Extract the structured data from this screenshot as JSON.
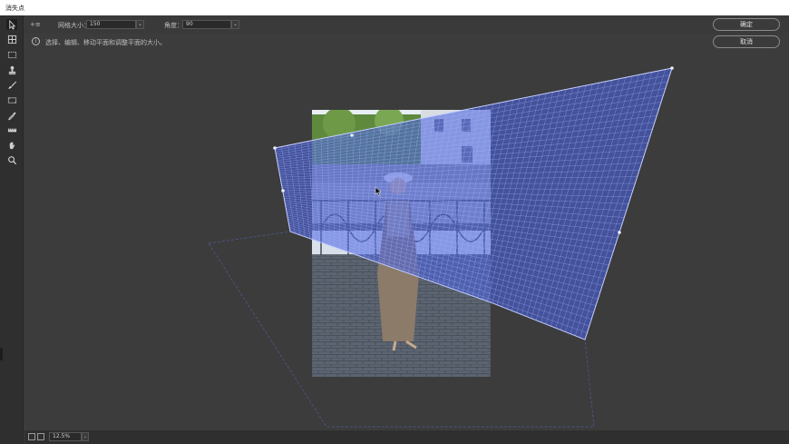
{
  "window": {
    "title": "消失点"
  },
  "toolbar": {
    "tools": [
      {
        "name": "edit-plane-tool",
        "icon": "arrow-cursor-icon"
      },
      {
        "name": "create-plane-tool",
        "icon": "grid-plane-icon"
      },
      {
        "name": "marquee-tool",
        "icon": "marquee-icon"
      },
      {
        "name": "stamp-tool",
        "icon": "stamp-icon"
      },
      {
        "name": "brush-tool",
        "icon": "brush-icon"
      },
      {
        "name": "transform-tool",
        "icon": "transform-icon"
      },
      {
        "name": "eyedropper-tool",
        "icon": "eyedropper-icon"
      },
      {
        "name": "measure-tool",
        "icon": "ruler-icon"
      },
      {
        "name": "hand-tool",
        "icon": "hand-icon"
      },
      {
        "name": "zoom-tool",
        "icon": "magnifier-icon"
      }
    ]
  },
  "options": {
    "corner_mark": "+≡",
    "grid_size_label": "网格大小：",
    "grid_size_value": "150",
    "angle_label": "角度：",
    "angle_value": "90"
  },
  "buttons": {
    "ok": "确定",
    "cancel": "取消"
  },
  "info": {
    "icon": "i",
    "text": "选择、编辑、移动平面和调整平面的大小。"
  },
  "status": {
    "zoom": "12.5%"
  },
  "colors": {
    "plane_fill": "#4a63e0",
    "plane_grid": "#8a9cff",
    "background": "#3c3c3c"
  }
}
